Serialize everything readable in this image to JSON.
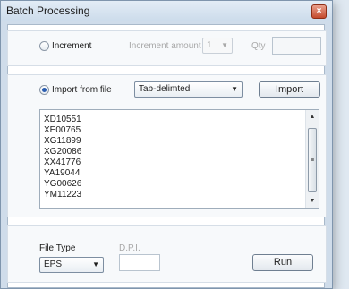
{
  "window": {
    "title": "Batch Processing",
    "close_symbol": "×"
  },
  "increment": {
    "radio_label": "Increment",
    "amount_label": "Increment amount",
    "amount_value": "1",
    "qty_label": "Qty",
    "qty_value": ""
  },
  "import": {
    "radio_label": "Import from file",
    "format_value": "Tab-delimted",
    "import_button": "Import"
  },
  "list": {
    "items": [
      "XD10551",
      "XE00765",
      "XG11899",
      "XG20086",
      "XX41776",
      "YA19044",
      "YG00626",
      "YM11223"
    ]
  },
  "footer": {
    "file_type_label": "File Type",
    "file_type_value": "EPS",
    "dpi_label": "D.P.I.",
    "dpi_value": "",
    "run_button": "Run"
  },
  "icons": {
    "dropdown_arrow": "▼",
    "scroll_up": "▲",
    "scroll_down": "▼",
    "grip": "≡"
  }
}
